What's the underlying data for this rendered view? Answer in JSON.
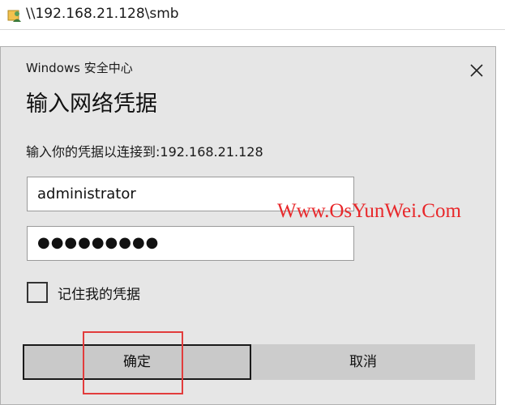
{
  "address_bar": {
    "path": "\\\\192.168.21.128\\smb",
    "icon": "network-user-folder-icon"
  },
  "dialog": {
    "title": "Windows 安全中心",
    "heading": "输入网络凭据",
    "subtitle": "输入你的凭据以连接到:192.168.21.128",
    "username": {
      "value": "administrator"
    },
    "password": {
      "masked_value": "●●●●●●●●●"
    },
    "remember": {
      "label": "记住我的凭据",
      "checked": false
    },
    "buttons": {
      "ok_label": "确定",
      "cancel_label": "取消"
    },
    "close_icon": "close-icon"
  },
  "watermark": {
    "text": "Www.OsYunWei.Com",
    "color": "#e8282b"
  },
  "highlight": {
    "color": "#e23c3c",
    "target": "ok-button"
  },
  "colors": {
    "dialog_bg": "#e6e6e6",
    "button_bg": "#c9c9c9",
    "field_border": "#9a9a9a"
  }
}
